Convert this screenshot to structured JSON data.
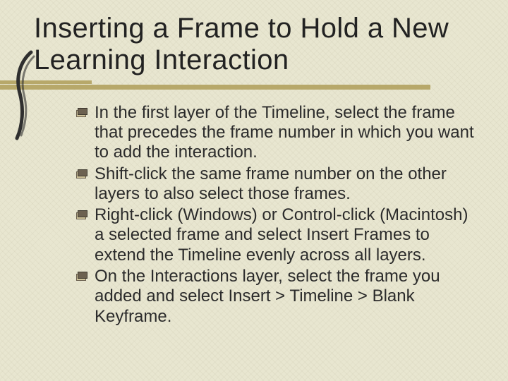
{
  "title": "Inserting a Frame to Hold a New Learning Interaction",
  "bullets": [
    "In the first layer of the Timeline, select the frame that precedes the frame number in which you want to add the interaction.",
    "Shift-click the same frame number on the other layers to also select those frames.",
    "Right-click (Windows) or Control-click (Macintosh) a selected frame and select Insert Frames to extend the Timeline evenly across all layers.",
    "On the Interactions layer, select the frame you added and select Insert > Timeline > Blank Keyframe."
  ],
  "colors": {
    "background": "#e8e6d0",
    "accent": "#b7a86a",
    "bullet_dark": "#6c6150",
    "bullet_light": "#cfc39a"
  }
}
